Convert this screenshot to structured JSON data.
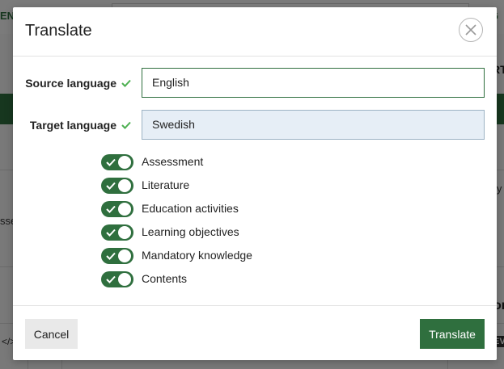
{
  "background": {
    "lang_link": "EN",
    "edge_right_top": "G",
    "edge_right_rt": "RT",
    "edge_left_asse": "sse",
    "edge_right_ly": "ly",
    "edge_right_on": "on",
    "code_icon": "</>",
    "edge_right_ev": "EV"
  },
  "modal": {
    "title": "Translate",
    "close_icon": "close-icon",
    "source_language": {
      "label": "Source language",
      "value": "English"
    },
    "target_language": {
      "label": "Target language",
      "value": "Swedish"
    },
    "options": [
      {
        "label": "Assessment",
        "enabled": true
      },
      {
        "label": "Literature",
        "enabled": true
      },
      {
        "label": "Education activities",
        "enabled": true
      },
      {
        "label": "Learning objectives",
        "enabled": true
      },
      {
        "label": "Mandatory knowledge",
        "enabled": true
      },
      {
        "label": "Contents",
        "enabled": true
      }
    ],
    "cancel_label": "Cancel",
    "translate_label": "Translate"
  },
  "colors": {
    "brand_green": "#2f6f3e",
    "valid_check": "#4caf50",
    "target_field_bg": "#e6eef6"
  }
}
